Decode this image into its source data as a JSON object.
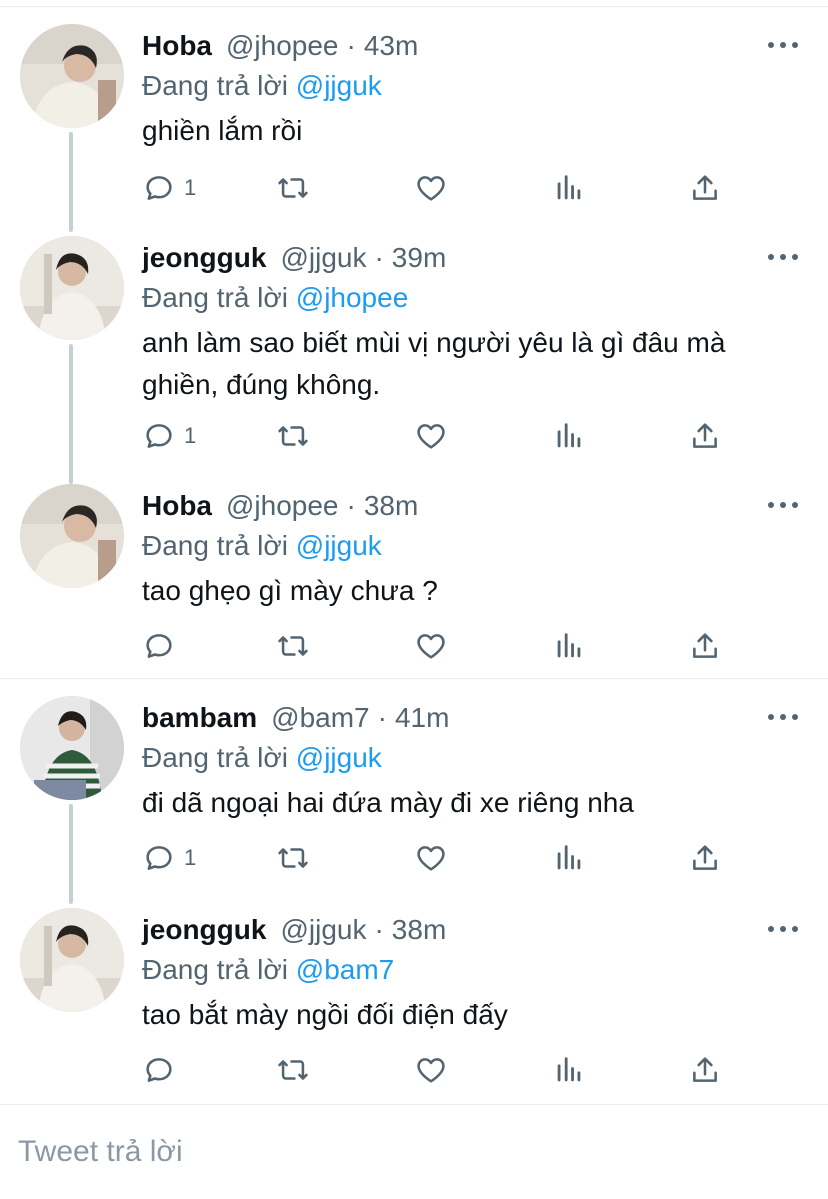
{
  "reply_prefix": "Đang trả lời",
  "tweets": [
    {
      "name": "Hoba",
      "handle": "@jhopee",
      "dot": "·",
      "time": "43m",
      "reply_to": "@jjguk",
      "text": "ghiền lắm rồi",
      "reply_count": "1"
    },
    {
      "name": "jeongguk",
      "handle": "@jjguk",
      "dot": "·",
      "time": "39m",
      "reply_to": "@jhopee",
      "text": "anh làm sao biết mùi vị người yêu là gì đâu mà ghiền, đúng không.",
      "reply_count": "1"
    },
    {
      "name": "Hoba",
      "handle": "@jhopee",
      "dot": "·",
      "time": "38m",
      "reply_to": "@jjguk",
      "text": "tao ghẹo gì mày chưa ?",
      "reply_count": ""
    },
    {
      "name": "bambam",
      "handle": "@bam7",
      "dot": "·",
      "time": "41m",
      "reply_to": "@jjguk",
      "text": "đi dã ngoại hai đứa mày đi xe riêng nha",
      "reply_count": "1"
    },
    {
      "name": "jeongguk",
      "handle": "@jjguk",
      "dot": "·",
      "time": "38m",
      "reply_to": "@bam7",
      "text": "tao bắt mày ngồi đối điện đấy",
      "reply_count": ""
    }
  ],
  "composer": {
    "placeholder": "Tweet trả lời"
  },
  "colors": {
    "accent": "#1d9bf0",
    "secondary_text": "#536471",
    "border": "#e6ecf0"
  }
}
